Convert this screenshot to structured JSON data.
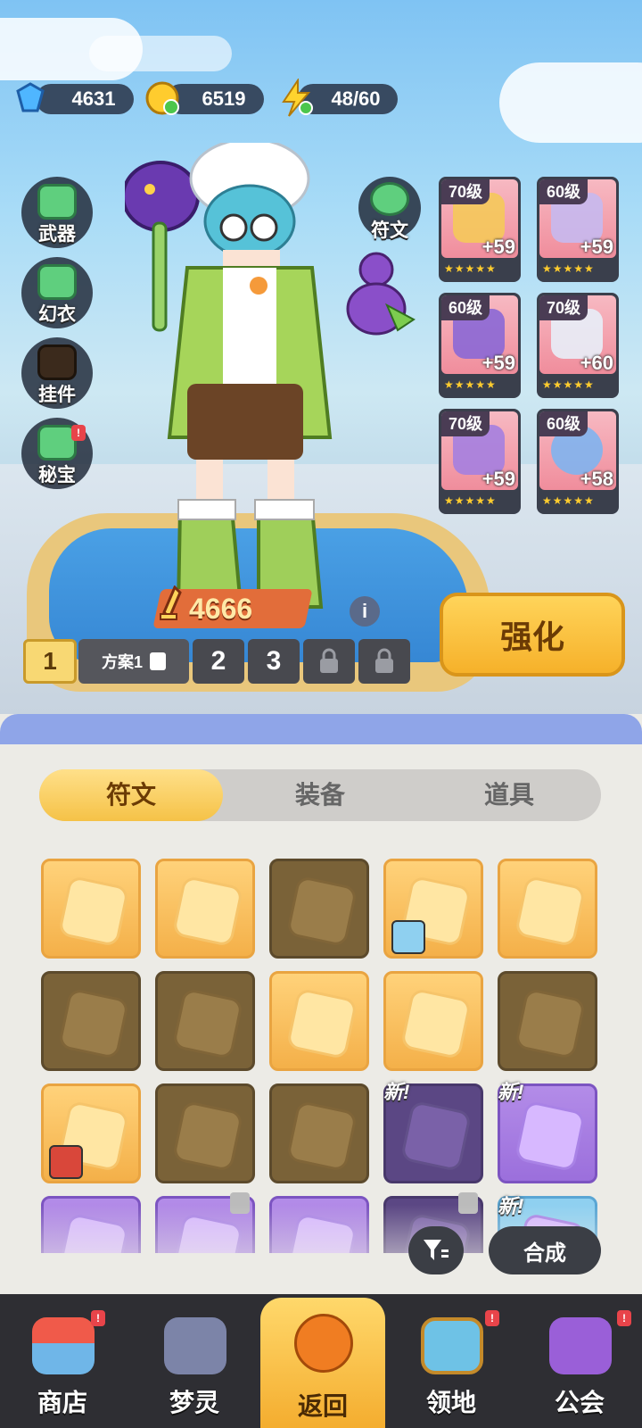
{
  "resources": {
    "diamonds": "4631",
    "gold": "6519",
    "stamina": "48/60"
  },
  "side_menu": {
    "weapon": "武器",
    "costume": "幻衣",
    "pendant": "挂件",
    "treasure": "秘宝",
    "rune": "符文"
  },
  "equipment": [
    {
      "level": "70级",
      "bonus": "+59"
    },
    {
      "level": "60级",
      "bonus": "+59"
    },
    {
      "level": "60级",
      "bonus": "+59"
    },
    {
      "level": "70级",
      "bonus": "+60"
    },
    {
      "level": "70级",
      "bonus": "+59"
    },
    {
      "level": "60级",
      "bonus": "+58"
    }
  ],
  "power": "4666",
  "info_label": "i",
  "strengthen_label": "强化",
  "plans": {
    "active": "1",
    "active_name": "方案1",
    "p2": "2",
    "p3": "3"
  },
  "tabs": [
    "符文",
    "装备",
    "道具"
  ],
  "new_badge": "新!",
  "combine_label": "合成",
  "bottom_nav": {
    "shop": "商店",
    "dream_spirit": "梦灵",
    "back": "返回",
    "territory": "领地",
    "guild": "公会"
  },
  "badge_mark": "!",
  "colors": {
    "accent_gold": "#f5c247",
    "panel_bg": "#ecebe6",
    "nav_bg": "#2e2e33"
  }
}
